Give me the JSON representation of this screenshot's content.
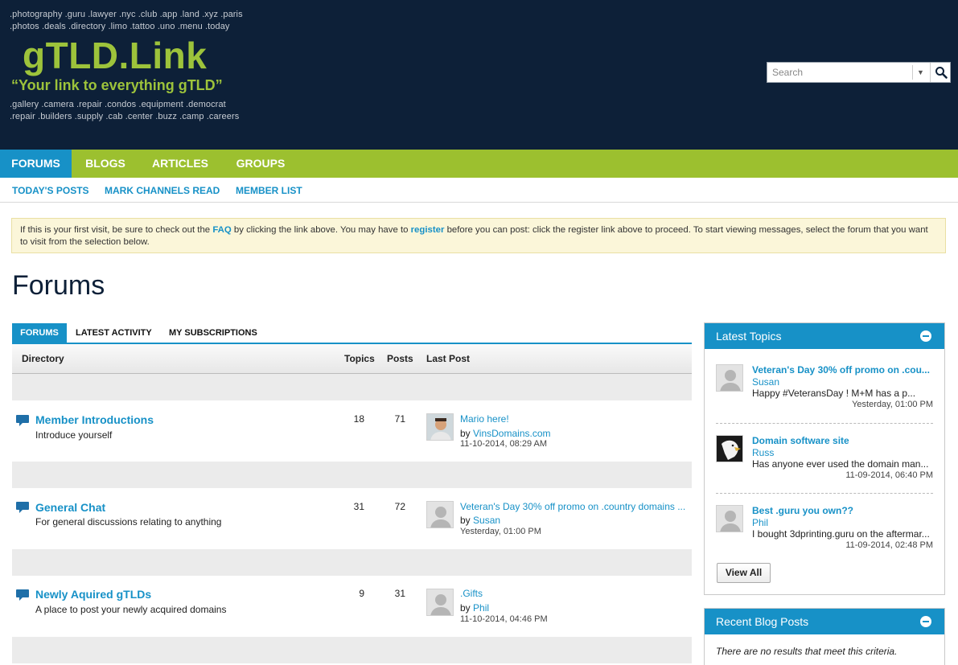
{
  "header": {
    "tld_lines_top": [
      ".photography .guru .lawyer .nyc .club .app .land .xyz .paris",
      ".photos .deals .directory .limo .tattoo .uno .menu .today"
    ],
    "tld_lines_bottom": [
      ".gallery .camera .repair .condos .equipment .democrat",
      ".repair .builders .supply .cab .center .buzz .camp .careers"
    ],
    "logo_title": "gTLD.Link",
    "logo_tagline": "“Your link to everything gTLD”",
    "search_placeholder": "Search"
  },
  "nav": {
    "tabs": [
      "FORUMS",
      "BLOGS",
      "ARTICLES",
      "GROUPS"
    ],
    "sub": [
      "TODAY'S POSTS",
      "MARK CHANNELS READ",
      "MEMBER LIST"
    ]
  },
  "notice": {
    "t1": "If this is your first visit, be sure to check out the ",
    "faq": "FAQ",
    "t2": " by clicking the link above. You may have to ",
    "register": "register",
    "t3": " before you can post: click the register link above to proceed. To start viewing messages, select the forum that you want to visit from the selection below."
  },
  "page_title": "Forums",
  "tabs": [
    "FORUMS",
    "LATEST ACTIVITY",
    "MY SUBSCRIPTIONS"
  ],
  "columns": {
    "directory": "Directory",
    "topics": "Topics",
    "posts": "Posts",
    "last_post": "Last Post"
  },
  "forums": [
    {
      "name": "Member Introductions",
      "desc": "Introduce yourself",
      "topics": "18",
      "posts": "71",
      "lp_title": "Mario here!",
      "by": "by ",
      "lp_user": "VinsDomains.com",
      "lp_date": "11-10-2014, 08:29 AM"
    },
    {
      "name": "General Chat",
      "desc": "For general discussions relating to anything",
      "topics": "31",
      "posts": "72",
      "lp_title": "Veteran's Day 30% off promo on .country domains ...",
      "by": "by ",
      "lp_user": "Susan",
      "lp_date": "Yesterday, 01:00 PM"
    },
    {
      "name": "Newly Aquired gTLDs",
      "desc": "A place to post your newly acquired domains",
      "topics": "9",
      "posts": "31",
      "lp_title": ".Gifts",
      "by": "by ",
      "lp_user": "Phil",
      "lp_date": "11-10-2014, 04:46 PM"
    }
  ],
  "sidebar": {
    "latest_title": "Latest Topics",
    "topics": [
      {
        "title": "Veteran's Day 30% off promo on .cou...",
        "user": "Susan",
        "text": "Happy #VeteransDay ! M+M has a p...",
        "date": "Yesterday, 01:00 PM"
      },
      {
        "title": "Domain software site",
        "user": "Russ",
        "text": "Has anyone ever used the domain man...",
        "date": "11-09-2014, 06:40 PM"
      },
      {
        "title": "Best .guru you own??",
        "user": "Phil",
        "text": "I bought 3dprinting.guru on the aftermar...",
        "date": "11-09-2014, 02:48 PM"
      }
    ],
    "view_all": "View All",
    "blog_title": "Recent Blog Posts",
    "blog_empty": "There are no results that meet this criteria."
  }
}
